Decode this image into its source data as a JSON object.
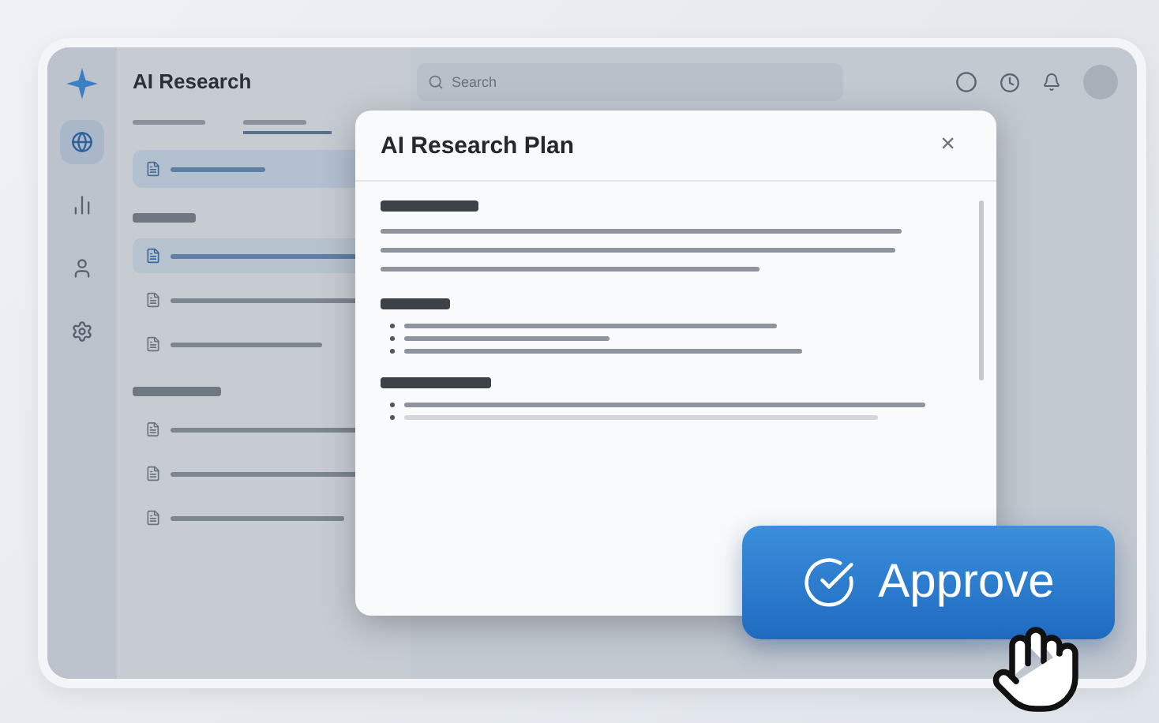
{
  "app": {
    "title": "AI Research",
    "search": {
      "placeholder": "Search"
    }
  },
  "rail": [
    {
      "kind": "globe",
      "selected": true
    },
    {
      "kind": "chart",
      "selected": false
    },
    {
      "kind": "user",
      "selected": false
    },
    {
      "kind": "gear",
      "selected": false
    }
  ],
  "sidebar": {
    "tabs": [
      {
        "selected": false
      },
      {
        "selected": true
      }
    ],
    "groups": [
      {
        "items": [
          {
            "selected": true
          },
          {
            "selected": false
          },
          {
            "selected": false
          }
        ]
      },
      {
        "items": [
          {
            "selected": false
          },
          {
            "selected": false
          },
          {
            "selected": false
          }
        ]
      }
    ]
  },
  "dialog": {
    "title": "AI Research Plan",
    "close": "×",
    "sections": [
      {
        "kind": "paragraph"
      },
      {
        "kind": "bullets"
      },
      {
        "kind": "bullets"
      }
    ]
  },
  "approve": {
    "label": "Approve"
  }
}
